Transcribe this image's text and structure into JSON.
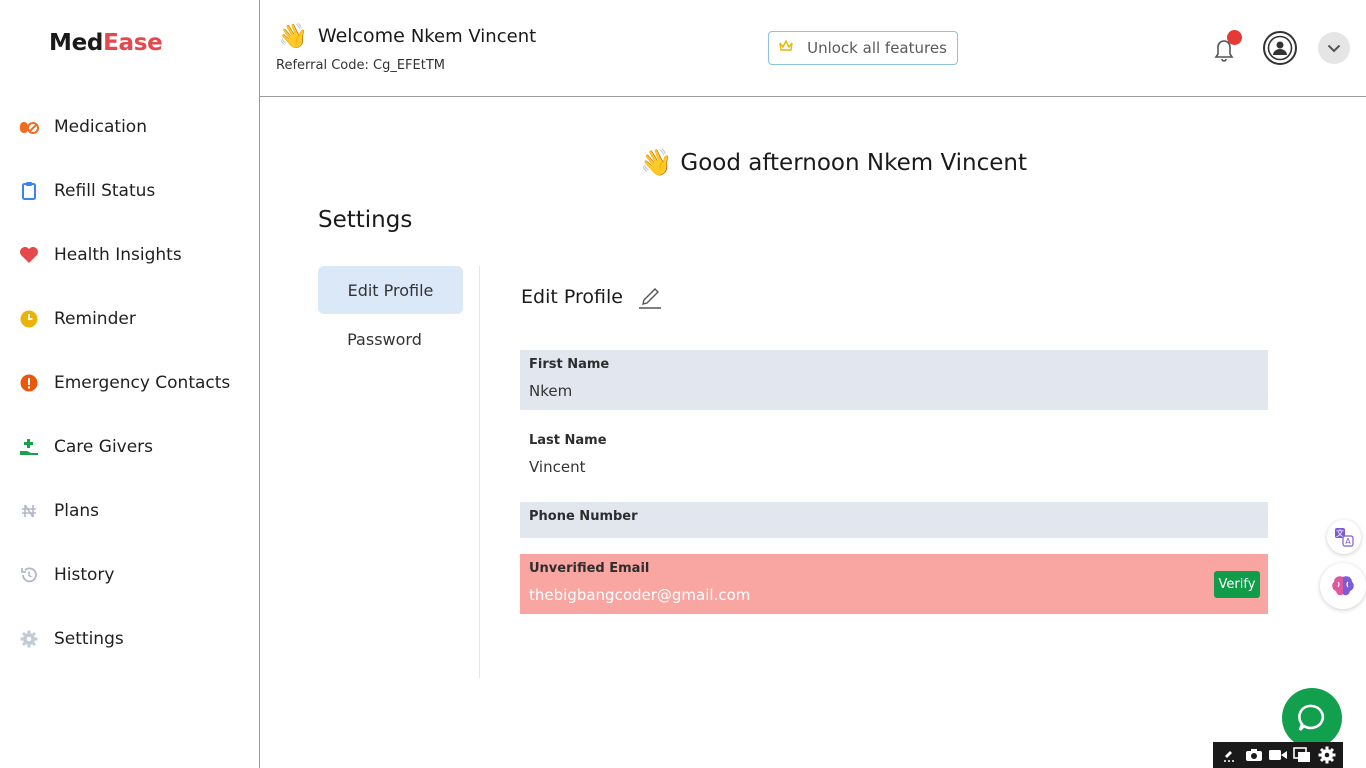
{
  "app": {
    "name_part1": "Med",
    "name_part2": "Ease",
    "brand_color": "#e5484d",
    "accent_color": "#119c4a"
  },
  "sidebar": {
    "items": [
      {
        "label": "Medication",
        "icon": "pills-icon",
        "color": "#f26b21"
      },
      {
        "label": "Refill Status",
        "icon": "clipboard-icon",
        "color": "#3b82f6"
      },
      {
        "label": "Health Insights",
        "icon": "heart-icon",
        "color": "#e5484d"
      },
      {
        "label": "Reminder",
        "icon": "clock-icon",
        "color": "#eab308"
      },
      {
        "label": "Emergency Contacts",
        "icon": "alert-icon",
        "color": "#ea580c"
      },
      {
        "label": "Care Givers",
        "icon": "hand-plus-icon",
        "color": "#16a34a"
      },
      {
        "label": "Plans",
        "icon": "naira-icon",
        "color": "#b0b8c8"
      },
      {
        "label": "History",
        "icon": "history-icon",
        "color": "#b0b8c8"
      },
      {
        "label": "Settings",
        "icon": "gear-icon",
        "color": "#b0b8c8"
      }
    ]
  },
  "header": {
    "welcome": "Welcome",
    "user_name": "Nkem Vincent",
    "referral": "Referral Code: Cg_EFEtTM",
    "unlock_label": "Unlock all features"
  },
  "main": {
    "greeting": "Good afternoon Nkem Vincent",
    "settings_title": "Settings",
    "tabs": [
      {
        "label": "Edit Profile",
        "active": true
      },
      {
        "label": "Password",
        "active": false
      }
    ],
    "edit_profile_title": "Edit Profile",
    "fields": {
      "first_name": {
        "label": "First Name",
        "value": "Nkem"
      },
      "last_name": {
        "label": "Last Name",
        "value": "Vincent"
      },
      "phone": {
        "label": "Phone Number",
        "value": ""
      },
      "email": {
        "label": "Unverified Email",
        "value": "thebigbangcoder@gmail.com",
        "action": "Verify"
      }
    }
  }
}
